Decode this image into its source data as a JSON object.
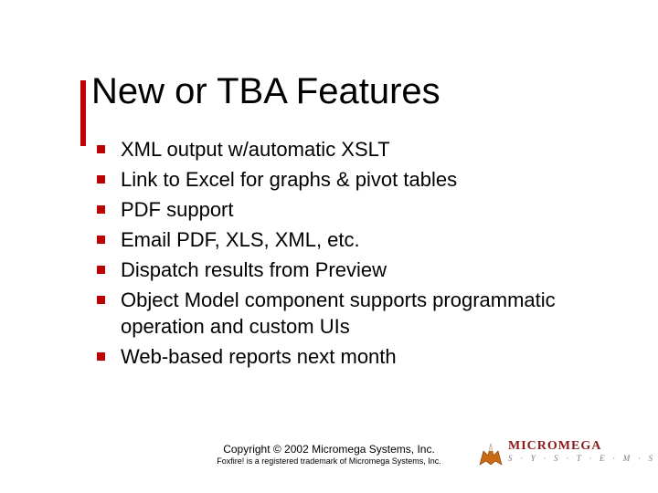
{
  "title": "New or TBA Features",
  "bullets": [
    "XML output w/automatic XSLT",
    "Link to Excel for graphs & pivot tables",
    "PDF support",
    "Email PDF, XLS, XML, etc.",
    "Dispatch results from Preview",
    "Object Model component supports programmatic operation and custom UIs",
    "Web-based reports next month"
  ],
  "footer": {
    "copyright": "Copyright © 2002 Micromega Systems, Inc.",
    "trademark": "Foxfire! is a registered trademark of Micromega Systems, Inc."
  },
  "logo": {
    "word": "MICROMEGA",
    "sub": "S·Y·S·T·E·M·S"
  }
}
